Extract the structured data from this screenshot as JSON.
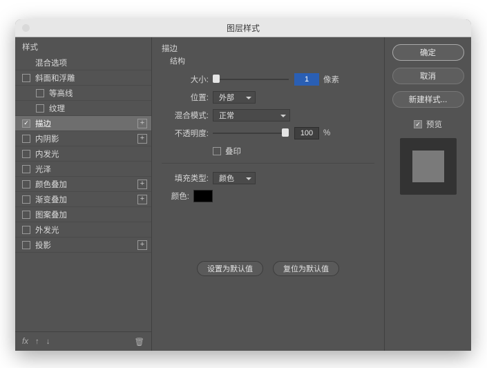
{
  "title": "图层样式",
  "sidebar": {
    "header": "样式",
    "blend_title": "混合选项",
    "items": [
      {
        "label": "斜面和浮雕",
        "checked": false,
        "add": false,
        "indent": false
      },
      {
        "label": "等高线",
        "checked": false,
        "add": false,
        "indent": true
      },
      {
        "label": "纹理",
        "checked": false,
        "add": false,
        "indent": true
      },
      {
        "label": "描边",
        "checked": true,
        "add": true,
        "indent": false,
        "selected": true
      },
      {
        "label": "内阴影",
        "checked": false,
        "add": true,
        "indent": false
      },
      {
        "label": "内发光",
        "checked": false,
        "add": false,
        "indent": false
      },
      {
        "label": "光泽",
        "checked": false,
        "add": false,
        "indent": false
      },
      {
        "label": "颜色叠加",
        "checked": false,
        "add": true,
        "indent": false
      },
      {
        "label": "渐变叠加",
        "checked": false,
        "add": true,
        "indent": false
      },
      {
        "label": "图案叠加",
        "checked": false,
        "add": false,
        "indent": false
      },
      {
        "label": "外发光",
        "checked": false,
        "add": false,
        "indent": false
      },
      {
        "label": "投影",
        "checked": false,
        "add": true,
        "indent": false
      }
    ],
    "fx_label": "fx"
  },
  "panel": {
    "group_title": "描边",
    "structure_title": "结构",
    "size_label": "大小:",
    "size_value": "1",
    "size_unit": "像素",
    "position_label": "位置:",
    "position_value": "外部",
    "blendmode_label": "混合模式:",
    "blendmode_value": "正常",
    "opacity_label": "不透明度:",
    "opacity_value": "100",
    "opacity_unit": "%",
    "overprint_label": "叠印",
    "filltype_label": "填充类型:",
    "filltype_value": "颜色",
    "color_label": "颜色:",
    "set_default": "设置为默认值",
    "reset_default": "复位为默认值"
  },
  "right": {
    "ok": "确定",
    "cancel": "取消",
    "new_style": "新建样式...",
    "preview": "预览"
  }
}
